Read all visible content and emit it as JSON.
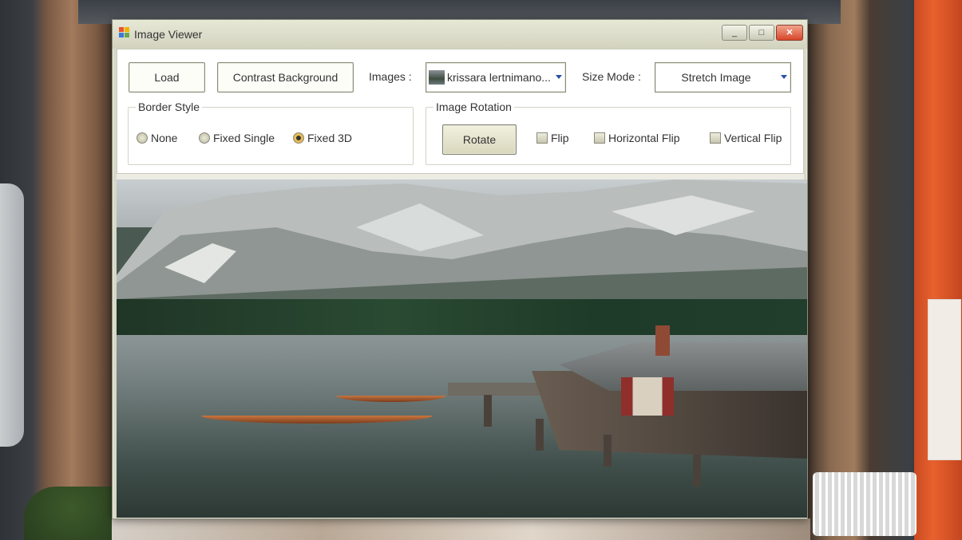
{
  "window": {
    "title": "Image Viewer",
    "minimize_glyph": "_",
    "maximize_glyph": "□",
    "close_glyph": "✕"
  },
  "toolbar": {
    "load_label": "Load",
    "contrast_label": "Contrast Background",
    "images_label": "Images :",
    "images_value": "krissara lertnimano...",
    "size_mode_label": "Size Mode :",
    "size_mode_value": "Stretch Image"
  },
  "border_style": {
    "title": "Border Style",
    "options": [
      {
        "label": "None",
        "selected": false
      },
      {
        "label": "Fixed Single",
        "selected": false
      },
      {
        "label": "Fixed 3D",
        "selected": true
      }
    ]
  },
  "image_rotation": {
    "title": "Image Rotation",
    "rotate_label": "Rotate",
    "checks": [
      {
        "label": "Flip",
        "checked": false
      },
      {
        "label": "Horizontal Flip",
        "checked": false
      },
      {
        "label": "Vertical Flip",
        "checked": false
      }
    ]
  },
  "colors": {
    "title_bar": "#d2d3bf",
    "close_button": "#d8462a",
    "combo_arrow": "#2a4fa8"
  },
  "icons": {
    "app": "app-icon",
    "combo_arrow": "chevron-down-icon"
  }
}
